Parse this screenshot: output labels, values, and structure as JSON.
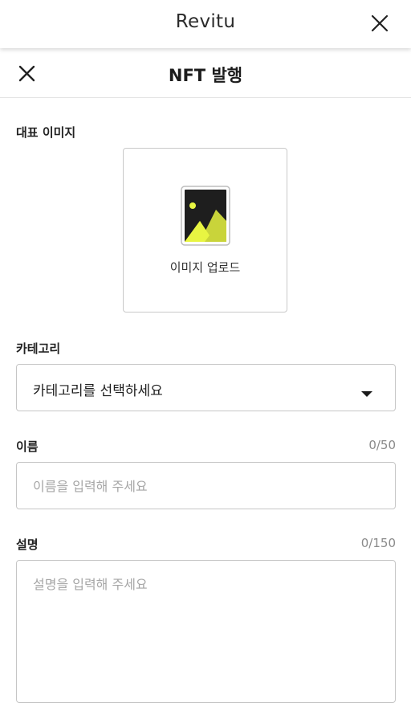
{
  "app_bar": {
    "title": "Revitu",
    "close_icon": "close-icon"
  },
  "nav_bar": {
    "title": "NFT 발행",
    "close_icon": "close-icon"
  },
  "image_section": {
    "label": "대표 이미지",
    "upload_label": "이미지 업로드",
    "icon": "image-placeholder-icon"
  },
  "category_section": {
    "label": "카테고리",
    "selected_value": "카테고리를 선택하세요",
    "dropdown_icon": "caret-down-icon"
  },
  "name_section": {
    "label": "이름",
    "counter": "0/50",
    "value": "",
    "placeholder": "이름을 입력해 주세요"
  },
  "description_section": {
    "label": "설명",
    "counter": "0/150",
    "value": "",
    "placeholder": "설명을 입력해 주세요"
  },
  "colors": {
    "icon_accent": "#e8f542",
    "icon_dark": "#1e1e1e"
  }
}
